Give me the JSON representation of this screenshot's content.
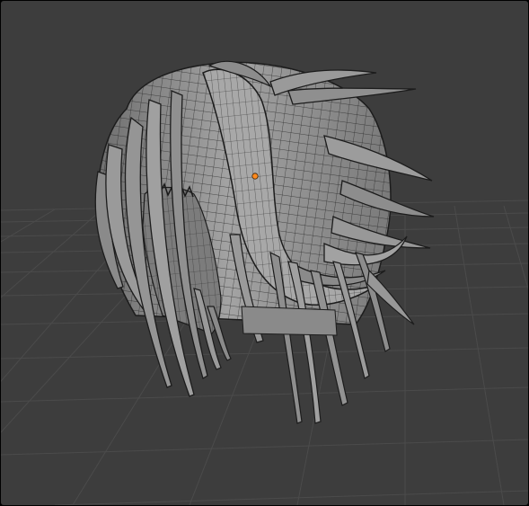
{
  "viewport": {
    "mode": "wireframe-overlay",
    "background_color": "#3d3d3d",
    "grid_color": "#4a4a4a",
    "mesh_fill_color": "#8f8f8f",
    "mesh_wire_color": "#1c1c1c",
    "origin_dot_color": "#ff8a1e",
    "object": "hair-mesh"
  }
}
